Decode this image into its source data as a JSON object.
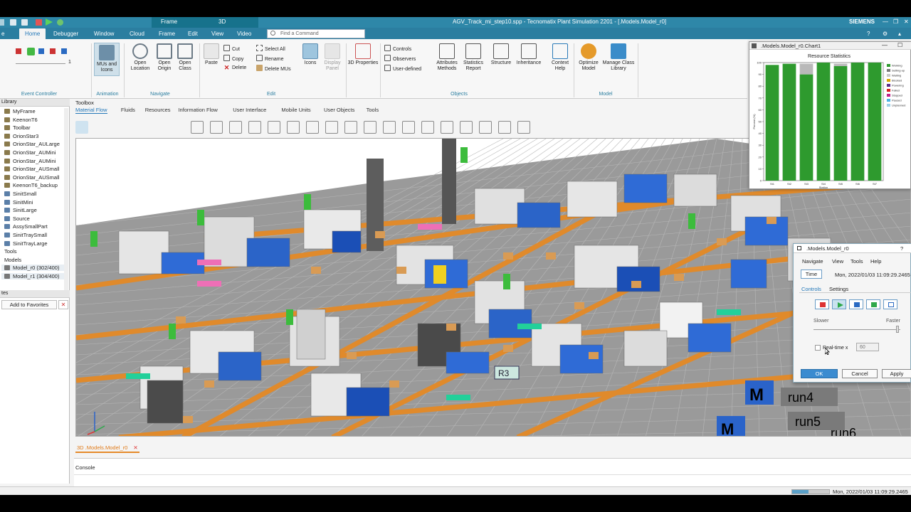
{
  "title_bar": {
    "context_tabs": [
      "Frame",
      "3D"
    ],
    "window_title": "AGV_Track_mi_step10.spp - Tecnomatix Plant Simulation 2201 - [.Models.Model_r0]",
    "brand": "SIEMENS"
  },
  "menu_tabs": [
    "Home",
    "Debugger",
    "Window",
    "Cloud",
    "Frame",
    "Edit",
    "View",
    "Video"
  ],
  "active_menu_tab": "Home",
  "find_placeholder": "Find a Command",
  "ribbon": {
    "event_controller": {
      "label": "Event Controller",
      "dial_value": "1"
    },
    "animation": {
      "button": "MUs and Icons",
      "label": "Animation"
    },
    "navigate": {
      "buttons": [
        "Open Location",
        "Open Origin",
        "Open Class"
      ],
      "label": "Navigate"
    },
    "edit": {
      "paste": "Paste",
      "small": [
        "Cut",
        "Copy",
        "Delete",
        "Select All",
        "Rename",
        "Delete MUs"
      ],
      "icons": "Icons",
      "display_panel": "Display Panel",
      "label": "Edit"
    },
    "three_d": {
      "button": "3D Properties"
    },
    "objects": {
      "small": [
        "Controls",
        "Observers",
        "User-defined"
      ],
      "buttons": [
        "Attributes Methods",
        "Statistics Report",
        "Structure",
        "Inheritance",
        "Context Help"
      ],
      "label": "Objects"
    },
    "model": {
      "buttons": [
        "Optimize Model",
        "Manage Class Library"
      ],
      "label": "Model"
    }
  },
  "class_library": {
    "header": "Library",
    "items": [
      "MyFrame",
      "KeenonT6",
      "Toolbar",
      "OrionStar3",
      "OrionStar_AULarge",
      "OrionStar_AUMini",
      "OrionStar_AUMini",
      "OrionStar_AUSmall",
      "OrionStar_AUSmall",
      "KeenonT6_backup",
      "SinitSmall",
      "SinitMini",
      "SinitLarge",
      "Source",
      "AssySmallPart",
      "SinitTraySmall",
      "SinitTrayLarge",
      "Tools",
      "Models",
      "Model_r0 (302/400)",
      "Model_r1 (304/400)"
    ]
  },
  "favorites": {
    "header": "tes",
    "button": "Add to Favorites"
  },
  "toolbox": {
    "title": "Toolbox",
    "tabs": [
      "Material Flow",
      "Fluids",
      "Resources",
      "Information Flow",
      "User Interface",
      "Mobile Units",
      "User Objects",
      "Tools"
    ]
  },
  "chart_window": {
    "title": ".Models.Model_r0.Chart1",
    "chart_data": {
      "type": "bar",
      "title": "Resource Statistics",
      "xlabel": "Station",
      "ylabel": "Percent (%)",
      "ylim": [
        0,
        100
      ],
      "yticks": [
        0,
        10,
        20,
        30,
        40,
        50,
        60,
        70,
        80,
        90,
        100
      ],
      "categories": [
        "St1",
        "St2",
        "St3",
        "St4",
        "St5",
        "St6",
        "St7"
      ],
      "series": [
        {
          "name": "Working",
          "color": "#2e9a2e",
          "values": [
            98,
            99,
            90,
            100,
            97,
            100,
            100
          ]
        },
        {
          "name": "Setting-up",
          "color": "#b9b9b9",
          "values": [
            0,
            0,
            9,
            0,
            2,
            0,
            0
          ]
        }
      ],
      "legend": [
        "Working",
        "Setting-up",
        "Waiting",
        "Blocked",
        "Powering",
        "Failed",
        "Stopped",
        "Paused",
        "Unplanned"
      ],
      "legend_colors": [
        "#2e9a2e",
        "#7a7a7a",
        "#c8c8c8",
        "#d9a600",
        "#5a2a8a",
        "#d81e1e",
        "#c01f8b",
        "#4db3e6",
        "#9fd0e8"
      ],
      "legend_position": "right"
    }
  },
  "dialog": {
    "title": ".Models.Model_r0",
    "menu": [
      "Navigate",
      "View",
      "Tools",
      "Help"
    ],
    "time_button": "Time",
    "time_value": "Mon, 2022/01/03 11:09:29.2465",
    "tabs": [
      "Controls",
      "Settings"
    ],
    "slower": "Slower",
    "faster": "Faster",
    "realtime_label": "Real-time x",
    "realtime_value": "60",
    "buttons": [
      "OK",
      "Cancel",
      "Apply"
    ]
  },
  "document_tab": "3D .Models.Model_r0",
  "console_label": "Console",
  "status_time": "Mon, 2022/01/03 11:09:29.2465",
  "scene_labels": [
    "R3",
    "M",
    "run4",
    "run5",
    "run6",
    "M"
  ]
}
